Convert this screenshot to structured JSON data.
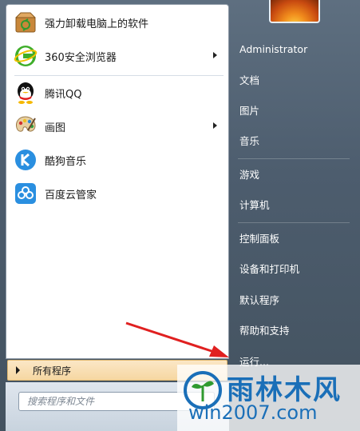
{
  "pinned_programs": [
    {
      "label": "强力卸载电脑上的软件",
      "icon": "uninstaller-box-icon",
      "has_submenu": false
    },
    {
      "label": "360安全浏览器",
      "icon": "360-browser-icon",
      "has_submenu": true
    }
  ],
  "recent_programs": [
    {
      "label": "腾讯QQ",
      "icon": "qq-penguin-icon",
      "has_submenu": false
    },
    {
      "label": "画图",
      "icon": "paint-palette-icon",
      "has_submenu": true
    },
    {
      "label": "酷狗音乐",
      "icon": "kugou-music-icon",
      "has_submenu": false
    },
    {
      "label": "百度云管家",
      "icon": "baidu-cloud-icon",
      "has_submenu": false
    }
  ],
  "all_programs_label": "所有程序",
  "search": {
    "placeholder": "搜索程序和文件"
  },
  "right_pane": {
    "username": "Administrator",
    "items": [
      "文档",
      "图片",
      "音乐",
      "游戏",
      "计算机",
      "控制面板",
      "设备和打印机",
      "默认程序",
      "帮助和支持",
      "运行..."
    ]
  },
  "watermark": {
    "title": "雨林木风",
    "url": "win2007.com"
  },
  "colors": {
    "accent_arrow": "#e02020",
    "watermark_blue": "#1a6fb8",
    "all_programs_bg": "#f6d7a2"
  }
}
